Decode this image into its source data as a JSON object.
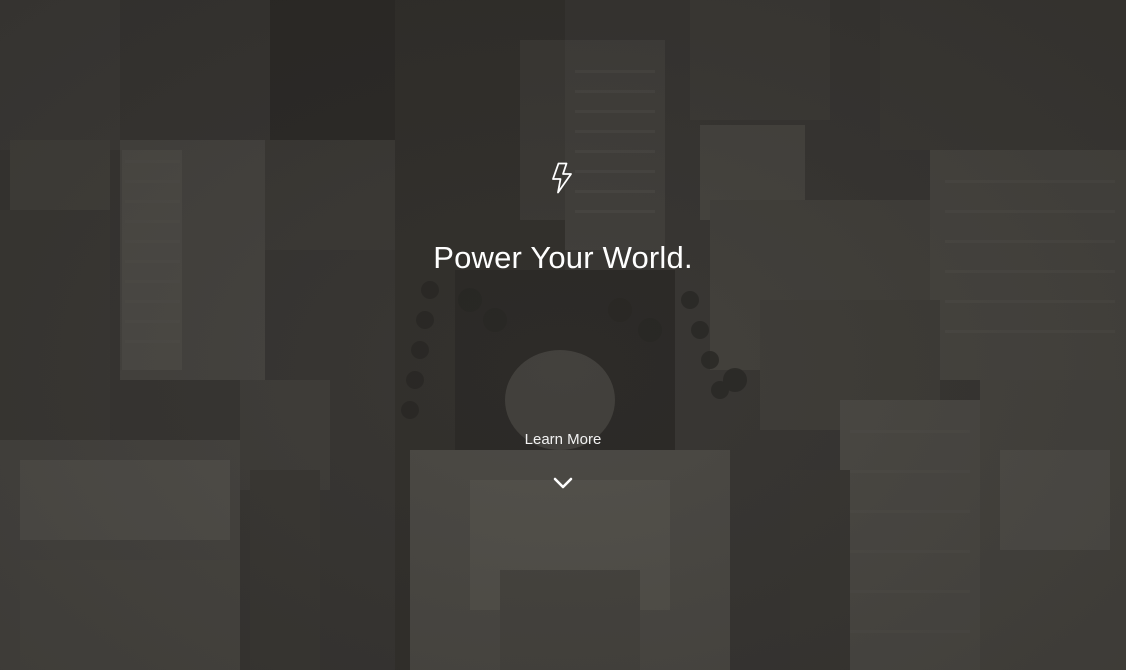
{
  "hero": {
    "headline": "Power Your World.",
    "learn_more_label": "Learn More",
    "icons": {
      "top": "lightning-bolt-icon",
      "cta": "chevron-down-icon"
    },
    "colors": {
      "text": "#ffffff",
      "background_tint": "#3a3835"
    }
  }
}
